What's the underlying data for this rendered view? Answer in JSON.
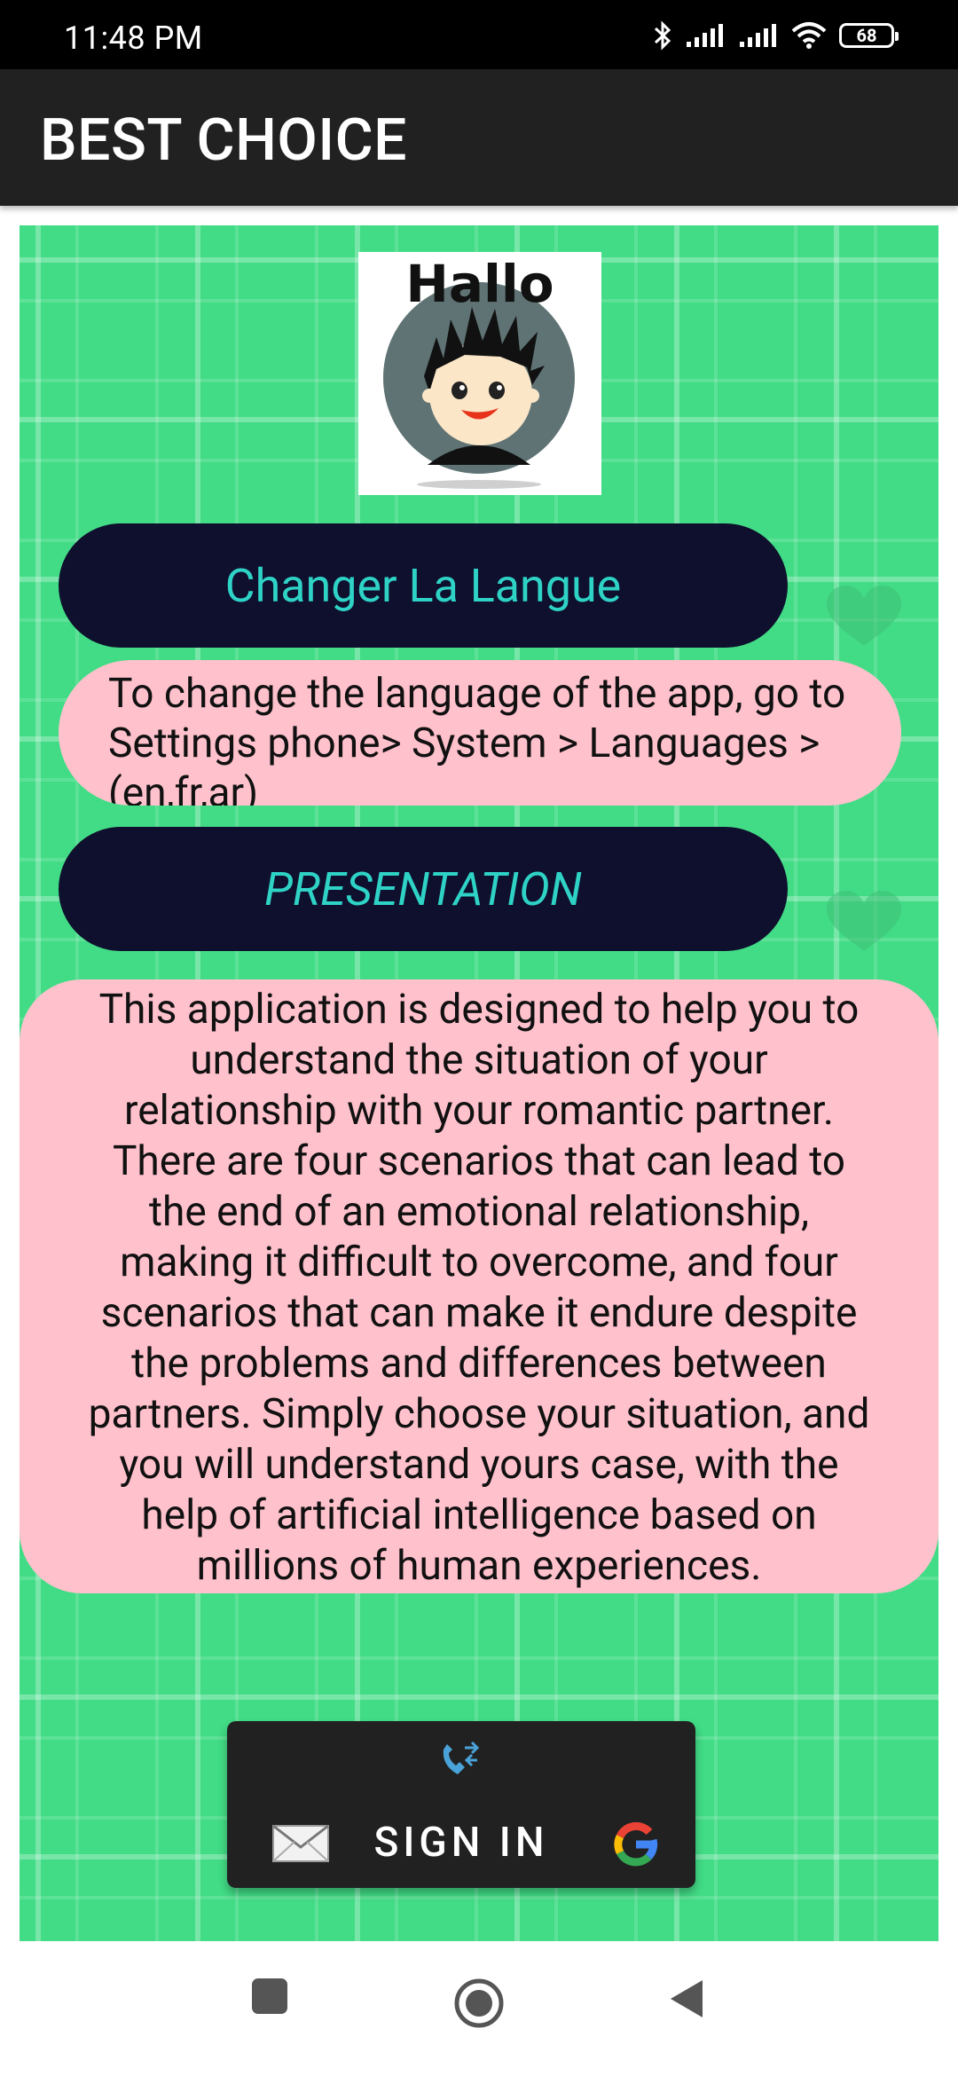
{
  "status_bar": {
    "time": "11:48 PM",
    "battery": "68",
    "icons": [
      "bluetooth-icon",
      "signal-icon",
      "signal-icon",
      "wifi-icon",
      "battery-icon"
    ]
  },
  "app_bar": {
    "title": "BEST CHOICE"
  },
  "logo": {
    "text": "Hallo"
  },
  "buttons": {
    "language": "Changer La Langue",
    "presentation": "PRESENTATION"
  },
  "language_info": "To change the language of the app, go to Settings phone> System > Languages >(en,fr,ar)",
  "presentation_text": "This application is designed to help you to understand the situation of your relationship with your romantic partner. There are four scenarios that can lead to the end of an emotional relationship, making it difficult to overcome, and four scenarios that can make it endure despite the problems and differences between partners. Simply choose your situation, and you will understand yours case, with the help of artificial intelligence based on millions of human experiences.",
  "signin": {
    "label": "SIGN IN",
    "icons": [
      "phone-icon",
      "mail-icon",
      "google-icon"
    ]
  },
  "colors": {
    "background_green": "#42dc86",
    "pill_dark": "#0f0f2e",
    "pill_text": "#2ed3c6",
    "pill_pink": "#ffc1cc",
    "app_bar": "#212121"
  },
  "nav_bar": {
    "icons": [
      "recents-icon",
      "home-icon",
      "back-icon"
    ]
  }
}
